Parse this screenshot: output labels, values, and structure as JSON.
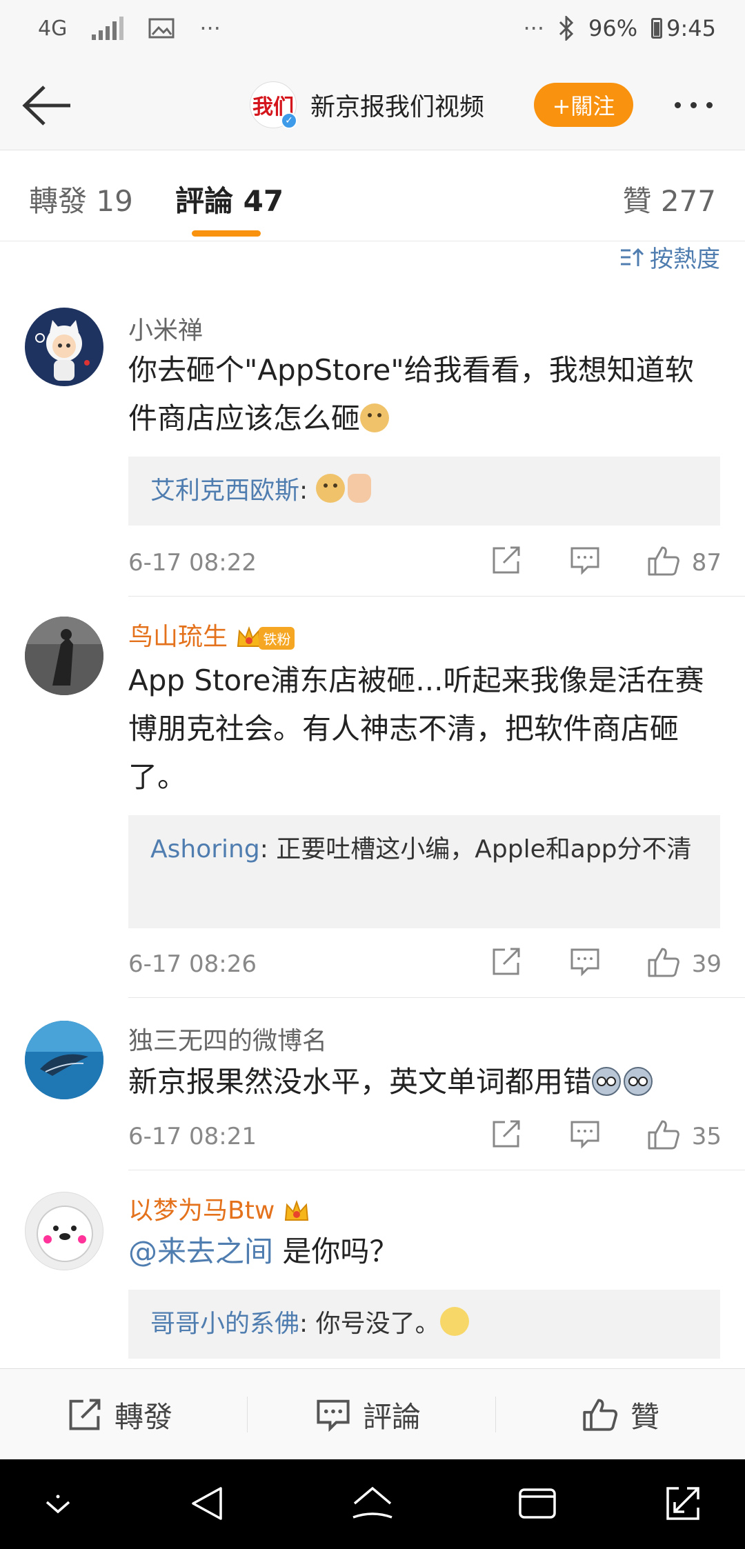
{
  "status_bar": {
    "network": "4G",
    "battery": "96%",
    "time": "9:45",
    "more": "···"
  },
  "header": {
    "logo_text": "我们",
    "account": "新京报我们视频",
    "follow_label": "+關注"
  },
  "tabs": {
    "repost": "轉發 19",
    "comments": "評論 47",
    "likes": "贊 277"
  },
  "sort_label": "按熱度",
  "comments": [
    {
      "user": "小米禅",
      "text": "你去砸个\"AppStore\"给我看看，我想知道软件商店应该怎么砸",
      "reply_user": "艾利克西欧斯",
      "reply_text": ": ",
      "time": "6-17 08:22",
      "likes": "87"
    },
    {
      "user": "鸟山琉生",
      "fan_badge": "铁粉",
      "text": "App Store浦东店被砸...听起来我像是活在赛博朋克社会。有人神志不清，把软件商店砸了。",
      "reply_user": "Ashoring",
      "reply_text": ": 正要吐槽这小编，Apple和app分不清",
      "time": "6-17 08:26",
      "likes": "39"
    },
    {
      "user": "独三无四的微博名",
      "text": "新京报果然没水平，英文单词都用错",
      "time": "6-17 08:21",
      "likes": "35"
    },
    {
      "user": "以梦为马Btw",
      "mention": "@来去之间",
      "text": " 是你吗？",
      "reply_user": "哥哥小的系佛",
      "reply_text": ": 你号没了。"
    }
  ],
  "action_bar": {
    "repost": "轉發",
    "comment": "評論",
    "like": "贊"
  },
  "colors": {
    "accent": "#f9920f",
    "link": "#4f7db0",
    "vip_name": "#e4721c"
  }
}
